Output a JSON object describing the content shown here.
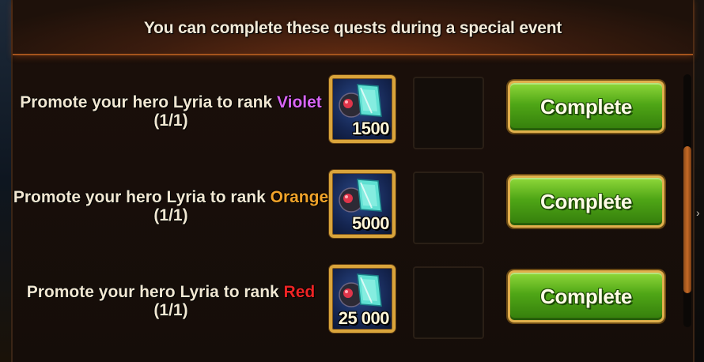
{
  "header": {
    "title": "You can complete these quests during a special event"
  },
  "quests": [
    {
      "prefix": "Promote your hero Lyria to rank ",
      "rank": "Violet",
      "rank_color": "#d865f3",
      "progress": "(1/1)",
      "reward_amount": "1500",
      "button_label": "Complete"
    },
    {
      "prefix": "Promote your hero Lyria to rank ",
      "rank": "Orange",
      "rank_color": "#f0a22a",
      "progress": "(1/1)",
      "reward_amount": "5000",
      "button_label": "Complete"
    },
    {
      "prefix": "Promote your hero Lyria to rank ",
      "rank": "Red",
      "rank_color": "#ee2424",
      "progress": "(1/1)",
      "reward_amount": "25 000",
      "button_label": "Complete"
    }
  ],
  "reward_icon": "soul-stone-icon",
  "scroll": {
    "position_fraction": 0.68
  },
  "colors": {
    "button_green": "#4fa616",
    "gold_border": "#d9a43b",
    "header_accent": "#a5541d"
  }
}
